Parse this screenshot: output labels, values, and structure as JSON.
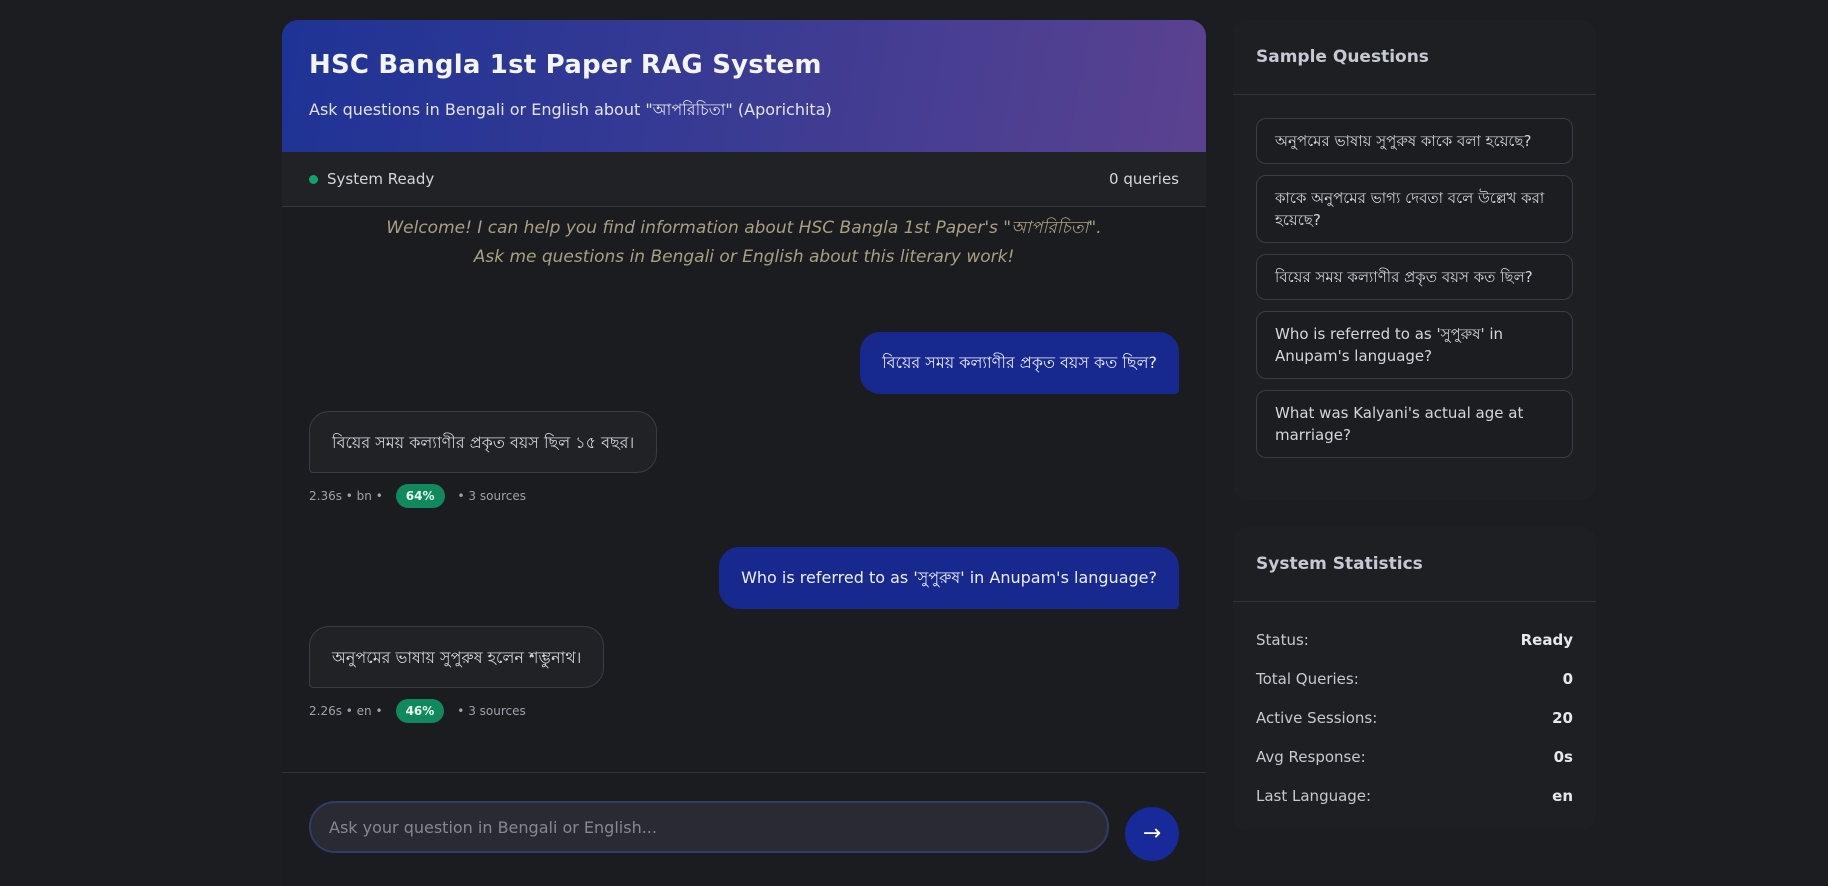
{
  "header": {
    "title": "HSC Bangla 1st Paper RAG System",
    "subtitle": "Ask questions in Bengali or English about \"আপরিচিতা\" (Aporichita)"
  },
  "status_bar": {
    "status": "System Ready",
    "queries": "0 queries",
    "status_color": "#10a36f"
  },
  "welcome": {
    "line1": "Welcome! I can help you find information about HSC Bangla 1st Paper's \"আপরিচিতা\".",
    "line2": "Ask me questions in Bengali or English about this literary work!"
  },
  "messages": [
    {
      "role": "user",
      "text": "বিয়ের সময় কল্যাণীর প্রকৃত বয়স কত ছিল?"
    },
    {
      "role": "bot",
      "text": "বিয়ের সময় কল্যাণীর প্রকৃত বয়স ছিল ১৫ বছর।",
      "meta_left": "2.36s • bn •",
      "confidence": "64%",
      "sources": "• 3 sources"
    },
    {
      "role": "user",
      "text": "Who is referred to as 'সুপুরুষ' in Anupam's language?"
    },
    {
      "role": "bot",
      "text": "অনুপমের ভাষায় সুপুরুষ হলেন শম্ভুনাথ।",
      "meta_left": "2.26s • en •",
      "confidence": "46%",
      "sources": "• 3 sources"
    }
  ],
  "input": {
    "placeholder": "Ask your question in Bengali or English...",
    "send_icon": "→"
  },
  "sample_questions": {
    "title": "Sample Questions",
    "items": [
      "অনুপমের ভাষায় সুপুরুষ কাকে বলা হয়েছে?",
      "কাকে অনুপমের ভাগ্য দেবতা বলে উল্লেখ করা হয়েছে?",
      "বিয়ের সময় কল্যাণীর প্রকৃত বয়স কত ছিল?",
      "Who is referred to as 'সুপুরুষ' in Anupam's language?",
      "What was Kalyani's actual age at marriage?"
    ]
  },
  "stats": {
    "title": "System Statistics",
    "rows": [
      {
        "label": "Status:",
        "value": "Ready"
      },
      {
        "label": "Total Queries:",
        "value": "0"
      },
      {
        "label": "Active Sessions:",
        "value": "20"
      },
      {
        "label": "Avg Response:",
        "value": "0s"
      },
      {
        "label": "Last Language:",
        "value": "en"
      }
    ]
  },
  "colors": {
    "header_gradient_start": "#1e3396",
    "header_gradient_end": "#5b4290",
    "user_bubble": "#17298f",
    "confidence_badge": "#10895f"
  }
}
